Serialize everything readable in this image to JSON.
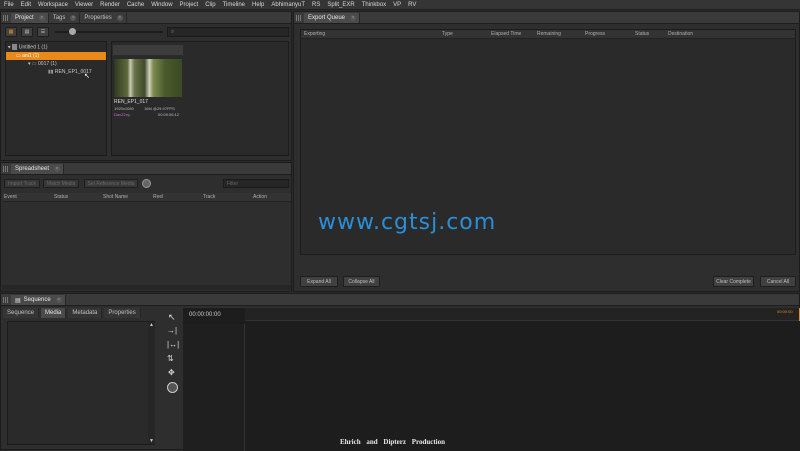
{
  "menu": [
    "File",
    "Edit",
    "Workspace",
    "Viewer",
    "Render",
    "Cache",
    "Window",
    "Project",
    "Clip",
    "Timeline",
    "Help",
    "AbhimanyuT",
    "RS",
    "Split_EXR",
    "Thinkbox",
    "VP",
    "RV"
  ],
  "project_panel": {
    "tabs": [
      "Project",
      "Tags",
      "Properties"
    ],
    "search_placeholder": "",
    "tree": {
      "root": "Untitled 1 (1)",
      "bin": "ani1 (1)",
      "sub": "0017 (1)",
      "clip": "REN_EP1_0017"
    },
    "thumb": {
      "name": "REN_EP1_017",
      "res": "1920x1080",
      "fps": "16M @29.97FPS",
      "codec": "DaxZ2ny",
      "duration": "00:09:56:12"
    }
  },
  "spreadsheet": {
    "tab": "Spreadsheet",
    "buttons": [
      "Import Track",
      "Match Media",
      "Set Reference Media"
    ],
    "filter_placeholder": "Filter",
    "columns": [
      "Event",
      "Status",
      "Shot Name",
      "Reel",
      "Track",
      "Action"
    ]
  },
  "export_queue": {
    "tab": "Export Queue",
    "columns": [
      "Exporting",
      "Type",
      "Elapsed Time",
      "Remaining",
      "Progress",
      "Status",
      "Destination"
    ],
    "buttons": {
      "expand": "Expand All",
      "collapse": "Collapse All",
      "clear": "Clear Complete",
      "cancel": "Cancel All"
    }
  },
  "sequence": {
    "tab": "Sequence",
    "subtabs": [
      "Sequence",
      "Media",
      "Metadata",
      "Properties"
    ],
    "timecode": "00:00:00:00",
    "ruler_end": "00:00:00"
  },
  "overlay": {
    "watermark": "www.cgtsj.com",
    "credit": "Ehrich and Dipterz Production"
  },
  "colors": {
    "accent": "#e8891a",
    "watermark": "#2a8fd8"
  }
}
